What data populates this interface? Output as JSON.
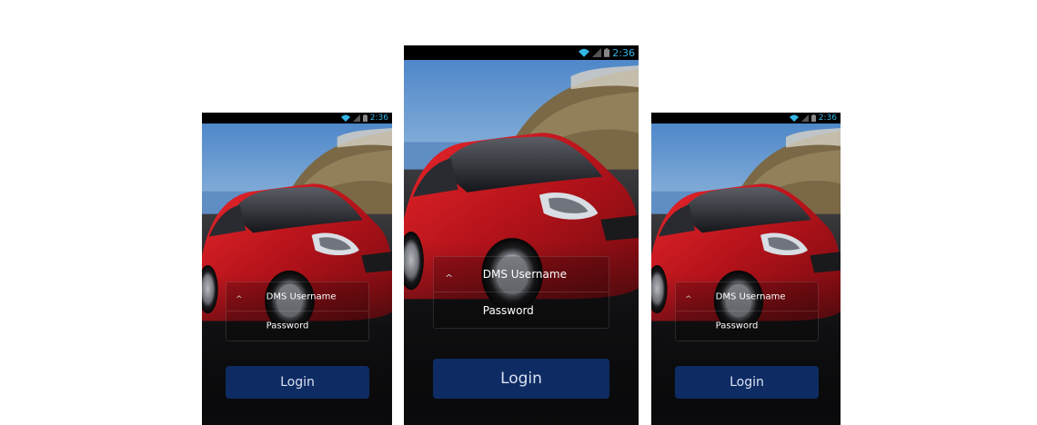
{
  "statusbar": {
    "time": "2:36"
  },
  "login": {
    "username_label": "DMS Username",
    "password_label": "Password",
    "button_label": "Login"
  },
  "colors": {
    "status_time": "#33b5e5",
    "button_bg": "#0e2b63",
    "car_body": "#c8151b"
  }
}
